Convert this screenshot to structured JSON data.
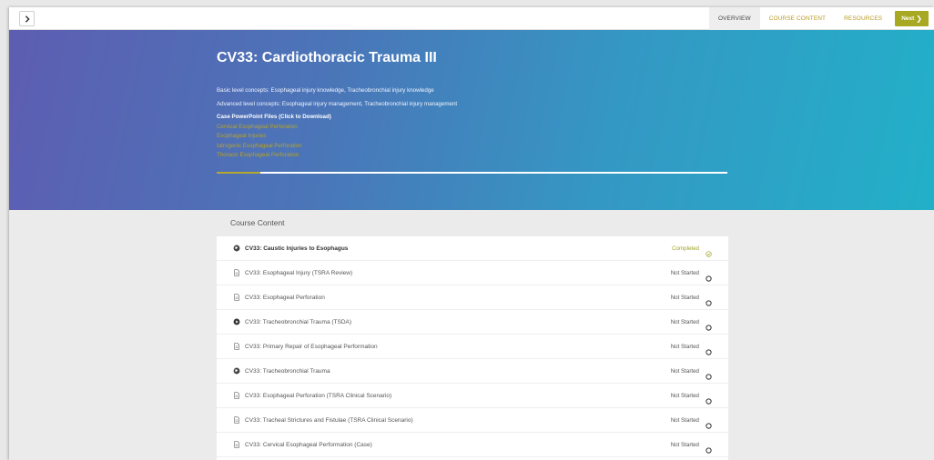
{
  "topbar": {
    "toggle_icon": "chevron-right-icon",
    "tabs": [
      {
        "label": "OVERVIEW",
        "active": true
      },
      {
        "label": "COURSE CONTENT",
        "active": false
      },
      {
        "label": "RESOURCES",
        "active": false
      }
    ],
    "next_label": "Next",
    "accent_color": "#a8a823"
  },
  "hero": {
    "title": "CV33: Cardiothoracic Trauma III",
    "basic_concepts": "Basic level concepts: Esophageal injury knowledge, Tracheobronchial injury knowledge",
    "advanced_concepts": "Advanced level concepts: Esophageal injury management, Tracheobronchial injury management",
    "ppt_heading": "Case PowerPoint Files (Click to Download)",
    "ppt_links": [
      "Cervical Esophageal Perforation",
      "Esophageal Injuries",
      "Iatrogenic Esophageal Perforation",
      "Thoracic Esophageal Perforation"
    ],
    "progress_fraction": 0.085
  },
  "content": {
    "title": "Course Content",
    "items": [
      {
        "label": "CV33: Caustic Injuries to Esophagus",
        "status": "Completed",
        "icon": "globe-icon",
        "bold": true,
        "completed": true
      },
      {
        "label": "CV33: Esophageal Injury (TSRA Review)",
        "status": "Not Started",
        "icon": "document-icon",
        "bold": false,
        "completed": false
      },
      {
        "label": "CV33: Esophageal Perforation",
        "status": "Not Started",
        "icon": "document-icon",
        "bold": false,
        "completed": false
      },
      {
        "label": "CV33: Tracheobronchial Trauma (TSDA)",
        "status": "Not Started",
        "icon": "play-icon",
        "bold": false,
        "completed": false
      },
      {
        "label": "CV33: Primary Repair of Esophageal Performation",
        "status": "Not Started",
        "icon": "document-icon",
        "bold": false,
        "completed": false
      },
      {
        "label": "CV33: Tracheobronchial Trauma",
        "status": "Not Started",
        "icon": "globe-icon",
        "bold": false,
        "completed": false
      },
      {
        "label": "CV33: Esophageal Perforation (TSRA Clinical Scenario)",
        "status": "Not Started",
        "icon": "document-icon",
        "bold": false,
        "completed": false
      },
      {
        "label": "CV33: Tracheal Strictures and Fistulae (TSRA Clinical Scenario)",
        "status": "Not Started",
        "icon": "document-icon",
        "bold": false,
        "completed": false
      },
      {
        "label": "CV33: Cervical Esophageal Performation (Case)",
        "status": "Not Started",
        "icon": "document-icon",
        "bold": false,
        "completed": false
      }
    ]
  }
}
